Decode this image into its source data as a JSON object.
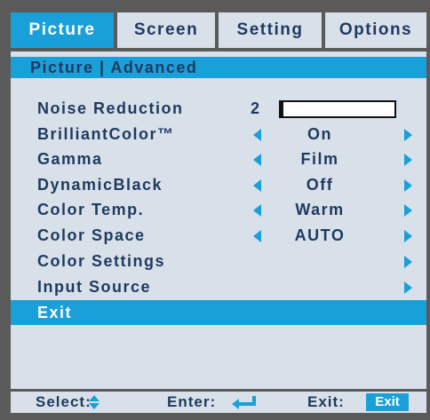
{
  "tabs": [
    {
      "label": "Picture",
      "active": true
    },
    {
      "label": "Screen",
      "active": false
    },
    {
      "label": "Setting",
      "active": false
    },
    {
      "label": "Options",
      "active": false
    }
  ],
  "breadcrumb": "Picture | Advanced",
  "noise_reduction": {
    "label": "Noise Reduction",
    "value": "2",
    "level_fraction": 0.02
  },
  "menu": [
    {
      "label": "BrilliantColor™",
      "value": "On"
    },
    {
      "label": "Gamma",
      "value": "Film"
    },
    {
      "label": "DynamicBlack",
      "value": "Off"
    },
    {
      "label": "Color Temp.",
      "value": "Warm"
    },
    {
      "label": "Color Space",
      "value": "AUTO"
    },
    {
      "label": "Color Settings",
      "value": ""
    },
    {
      "label": "Input Source",
      "value": ""
    },
    {
      "label": "Exit",
      "value": ""
    }
  ],
  "footer": {
    "select_label": "Select:",
    "enter_label": "Enter:",
    "exit_label": "Exit:",
    "exit_key": "Exit"
  },
  "colors": {
    "accent": "#1aa0d8",
    "panel": "#d8e0ea",
    "text": "#1e3a5f",
    "frame": "#5a5a5a"
  },
  "icons": [
    "left-arrow-icon",
    "right-arrow-icon",
    "up-down-arrows-icon",
    "enter-key-icon"
  ]
}
